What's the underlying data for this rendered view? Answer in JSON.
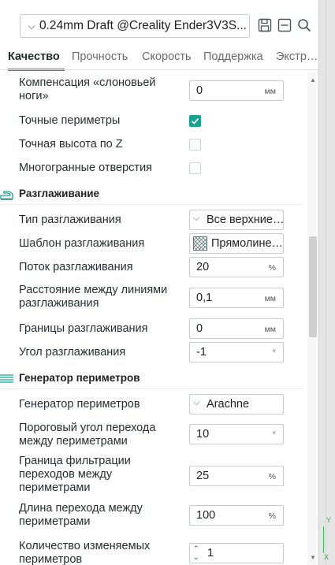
{
  "preset": {
    "chevron": "⌵",
    "label": "0.24mm Draft @Creality Ender3V3S..."
  },
  "toolbar": {
    "save_icon": "save-icon",
    "compare_icon": "compare-icon",
    "search_icon": "search-icon"
  },
  "tabs": [
    {
      "label": "Качество",
      "active": true
    },
    {
      "label": "Прочность"
    },
    {
      "label": "Скорость"
    },
    {
      "label": "Поддержка"
    },
    {
      "label": "Экстр…"
    }
  ],
  "quality": {
    "elephant_foot": {
      "label_line1": "Компенсация «слоновьей",
      "label_line2": "ноги»",
      "value": "0",
      "unit": "мм"
    },
    "precise_wall": {
      "label": "Точные периметры",
      "checked": true
    },
    "precise_z": {
      "label": "Точная высота по Z",
      "checked": false
    },
    "polyholes": {
      "label": "Многогранные отверстия",
      "checked": false
    }
  },
  "ironing": {
    "title": "Разглаживание",
    "type": {
      "label": "Тип разглаживания",
      "value": "Все верхние…"
    },
    "pattern": {
      "label": "Шаблон разглаживания",
      "value": "Прямолине…"
    },
    "flow": {
      "label": "Поток разглаживания",
      "value": "20",
      "unit": "%"
    },
    "spacing": {
      "label_line1": "Расстояние между линиями",
      "label_line2": "разглаживания",
      "value": "0,1",
      "unit": "мм"
    },
    "inset": {
      "label": "Границы разглаживания",
      "value": "0",
      "unit": "мм"
    },
    "angle": {
      "label": "Угол разглаживания",
      "value": "-1",
      "unit": "°"
    }
  },
  "wall_generator": {
    "title": "Генератор периметров",
    "generator": {
      "label": "Генератор периметров",
      "value": "Arachne"
    },
    "transition_angle": {
      "label_line1": "Пороговый угол перехода",
      "label_line2": "между периметрами",
      "value": "10",
      "unit": "°"
    },
    "transition_filter": {
      "label_line1": "Граница фильтрации",
      "label_line2": "переходов между",
      "label_line3": "периметрами",
      "value": "25",
      "unit": "%"
    },
    "transition_length": {
      "label_line1": "Длина перехода между",
      "label_line2": "периметрами",
      "value": "100",
      "unit": "%"
    },
    "distribution_count": {
      "label_line1": "Количество изменяемых",
      "label_line2": "периметров",
      "value": "1"
    }
  },
  "viewport_axes": {
    "y": "Y",
    "x": "X"
  },
  "colors": {
    "accent": "#15a392",
    "text": "#262e30"
  }
}
